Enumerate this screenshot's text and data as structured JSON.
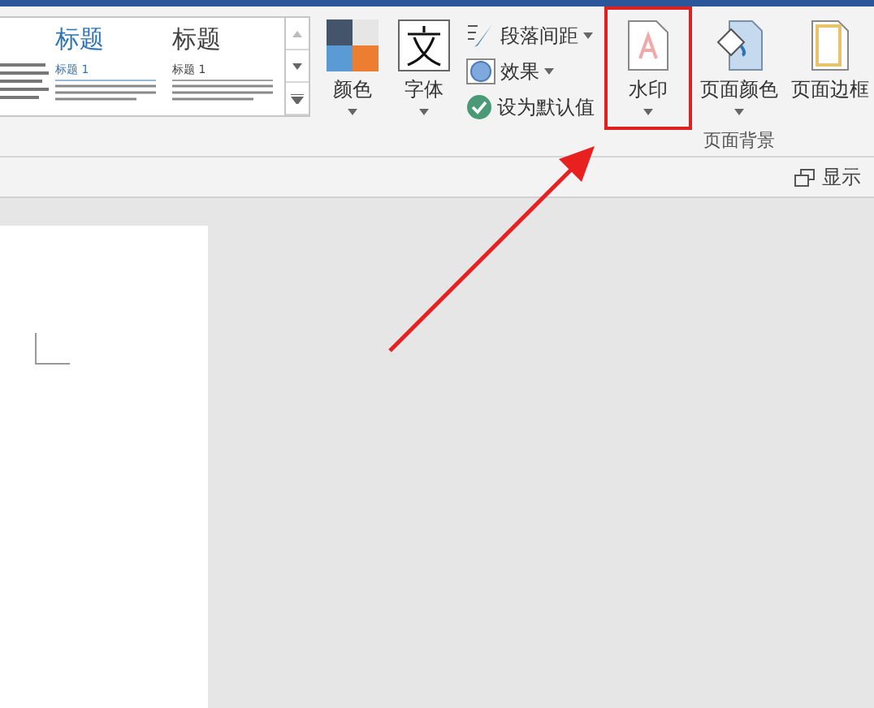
{
  "styles_gallery": {
    "items": [
      {
        "title": "标题",
        "heading": "标题 1",
        "color": "#2e74b5"
      },
      {
        "title": "标题",
        "heading": "标题 1",
        "color": "#404040"
      }
    ]
  },
  "design_buttons": [
    {
      "label": "颜色",
      "kind": "colors"
    },
    {
      "label": "字体",
      "kind": "fonts"
    }
  ],
  "design_small_buttons": [
    {
      "label": "段落间距",
      "kind": "spacing",
      "dropdown": true
    },
    {
      "label": "效果",
      "kind": "effects",
      "dropdown": true
    },
    {
      "label": "设为默认值",
      "kind": "default",
      "dropdown": false
    }
  ],
  "page_background": {
    "group_label": "页面背景",
    "buttons": [
      {
        "label": "水印",
        "kind": "watermark",
        "dropdown": true,
        "highlighted": true
      },
      {
        "label": "页面颜色",
        "kind": "page-color",
        "dropdown": true,
        "highlighted": false
      },
      {
        "label": "页面边框",
        "kind": "page-border",
        "dropdown": false,
        "highlighted": false
      }
    ]
  },
  "navigation_bar": {
    "label": "显示"
  }
}
